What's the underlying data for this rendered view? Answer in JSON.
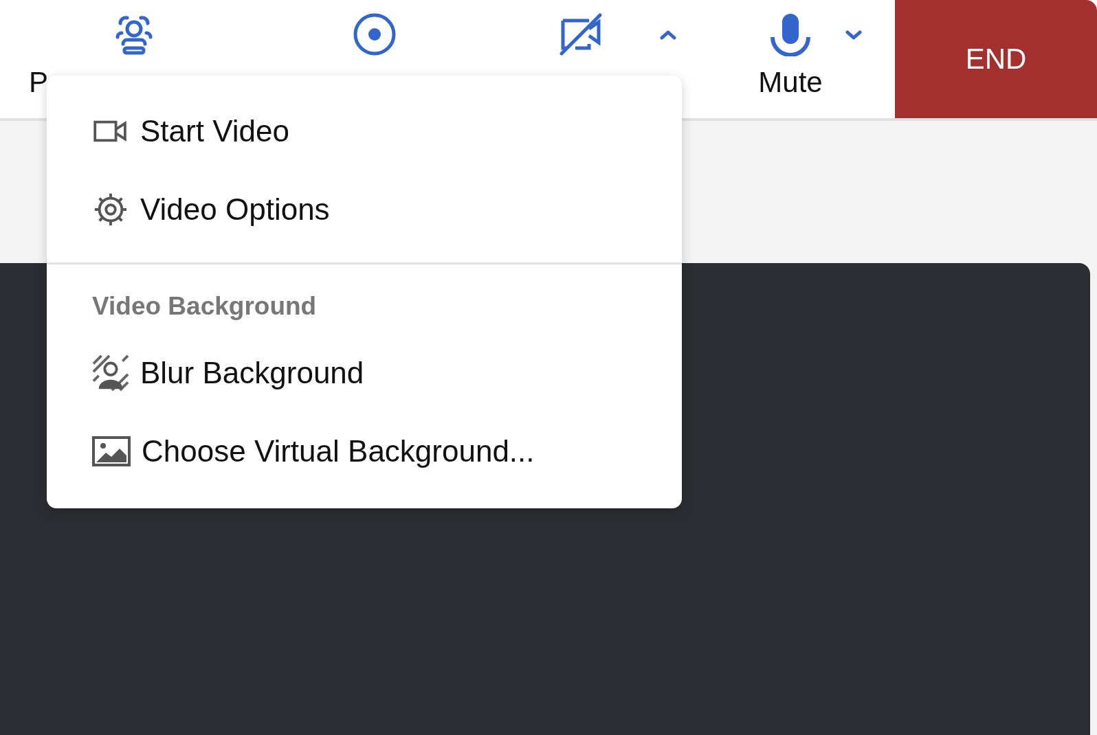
{
  "toolbar": {
    "buttons": [
      {
        "kind": "participants",
        "label": "P"
      },
      {
        "kind": "record"
      },
      {
        "kind": "video_off",
        "menu_open": true
      },
      {
        "kind": "mic",
        "label": "Mute",
        "menu_open": false
      }
    ],
    "end_button": {
      "label": "END"
    }
  },
  "video_menu": {
    "items": [
      {
        "kind": "video",
        "label": "Start Video"
      },
      {
        "kind": "gear",
        "label": "Video Options"
      },
      {
        "kind": "divider"
      },
      {
        "kind": "header",
        "label": "Video Background"
      },
      {
        "kind": "blur",
        "label": "Blur Background"
      },
      {
        "kind": "image",
        "label": "Choose Virtual Background..."
      }
    ]
  }
}
